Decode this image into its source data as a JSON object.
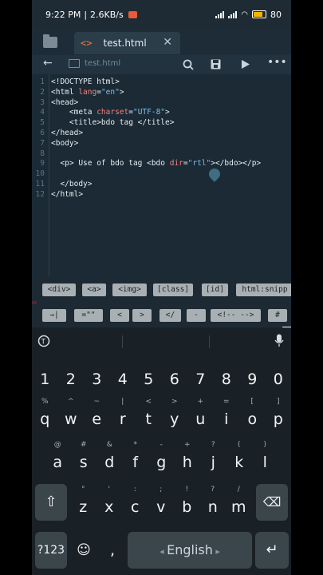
{
  "status": {
    "time": "9:22 PM",
    "speed": "2.6KB/s",
    "battery": "80"
  },
  "tab": {
    "code_icon": "<>",
    "label": "test.html",
    "close": "✕"
  },
  "breadcrumb": {
    "file": "test.html"
  },
  "editor": {
    "lines": [
      {
        "n": "1",
        "parts": [
          [
            "tag",
            "<!DOCTYPE html>"
          ]
        ]
      },
      {
        "n": "2",
        "parts": [
          [
            "tag",
            "<html "
          ],
          [
            "attr",
            "lang"
          ],
          [
            "tag",
            "="
          ],
          [
            "str",
            "\"en\""
          ],
          [
            "tag",
            ">"
          ]
        ]
      },
      {
        "n": "3",
        "parts": [
          [
            "tag",
            "<head>"
          ]
        ]
      },
      {
        "n": "4",
        "parts": [
          [
            "tag",
            "    <meta "
          ],
          [
            "attr",
            "charset"
          ],
          [
            "tag",
            "="
          ],
          [
            "str",
            "\"UTF-8\""
          ],
          [
            "tag",
            ">"
          ]
        ]
      },
      {
        "n": "5",
        "parts": [
          [
            "tag",
            "    <title>bdo tag </title>"
          ]
        ]
      },
      {
        "n": "6",
        "parts": [
          [
            "tag",
            "</head>"
          ]
        ]
      },
      {
        "n": "7",
        "parts": [
          [
            "tag",
            "<body>"
          ]
        ]
      },
      {
        "n": "8",
        "parts": []
      },
      {
        "n": "9",
        "parts": [
          [
            "tag",
            "  <p> Use of bdo tag <bdo "
          ],
          [
            "attr",
            "dir"
          ],
          [
            "tag",
            "="
          ],
          [
            "str",
            "\"rtl\""
          ],
          [
            "tag",
            "></bdo></p>"
          ]
        ]
      },
      {
        "n": "10",
        "parts": []
      },
      {
        "n": "11",
        "parts": [
          [
            "tag",
            "  </body>"
          ]
        ]
      },
      {
        "n": "12",
        "parts": [
          [
            "tag",
            "</html>"
          ]
        ]
      }
    ]
  },
  "snippets_row1": [
    "<div>",
    "<a>",
    "<img>",
    "[class]",
    "[id]",
    "html:snipp"
  ],
  "snippets_row2": [
    "→|",
    "=\"\"",
    "<",
    ">",
    "</",
    "-",
    "<!-- -->",
    "#"
  ],
  "keyboard": {
    "row1": [
      [
        "1",
        ""
      ],
      [
        "2",
        ""
      ],
      [
        "3",
        ""
      ],
      [
        "4",
        ""
      ],
      [
        "5",
        ""
      ],
      [
        "6",
        ""
      ],
      [
        "7",
        ""
      ],
      [
        "8",
        ""
      ],
      [
        "9",
        ""
      ],
      [
        "0",
        ""
      ]
    ],
    "row2": [
      [
        "q",
        "%"
      ],
      [
        "w",
        "^"
      ],
      [
        "e",
        "~"
      ],
      [
        "r",
        "|"
      ],
      [
        "t",
        "<"
      ],
      [
        "y",
        ">"
      ],
      [
        "u",
        "+"
      ],
      [
        "i",
        "="
      ],
      [
        "o",
        "["
      ],
      [
        "p",
        "]"
      ]
    ],
    "row3": [
      [
        "a",
        "@"
      ],
      [
        "s",
        "#"
      ],
      [
        "d",
        "&"
      ],
      [
        "f",
        "*"
      ],
      [
        "g",
        "-"
      ],
      [
        "h",
        "+"
      ],
      [
        "j",
        "?"
      ],
      [
        "k",
        "("
      ],
      [
        "l",
        ")"
      ]
    ],
    "row4": [
      [
        "z",
        "\""
      ],
      [
        "x",
        "'"
      ],
      [
        "c",
        ":"
      ],
      [
        "v",
        ";"
      ],
      [
        "b",
        "!"
      ],
      [
        "n",
        "?"
      ],
      [
        "m",
        "/"
      ]
    ],
    "symbols_label": "?123",
    "comma": ",",
    "space_label": "English",
    "period": ".",
    "enter_label": "↵"
  }
}
